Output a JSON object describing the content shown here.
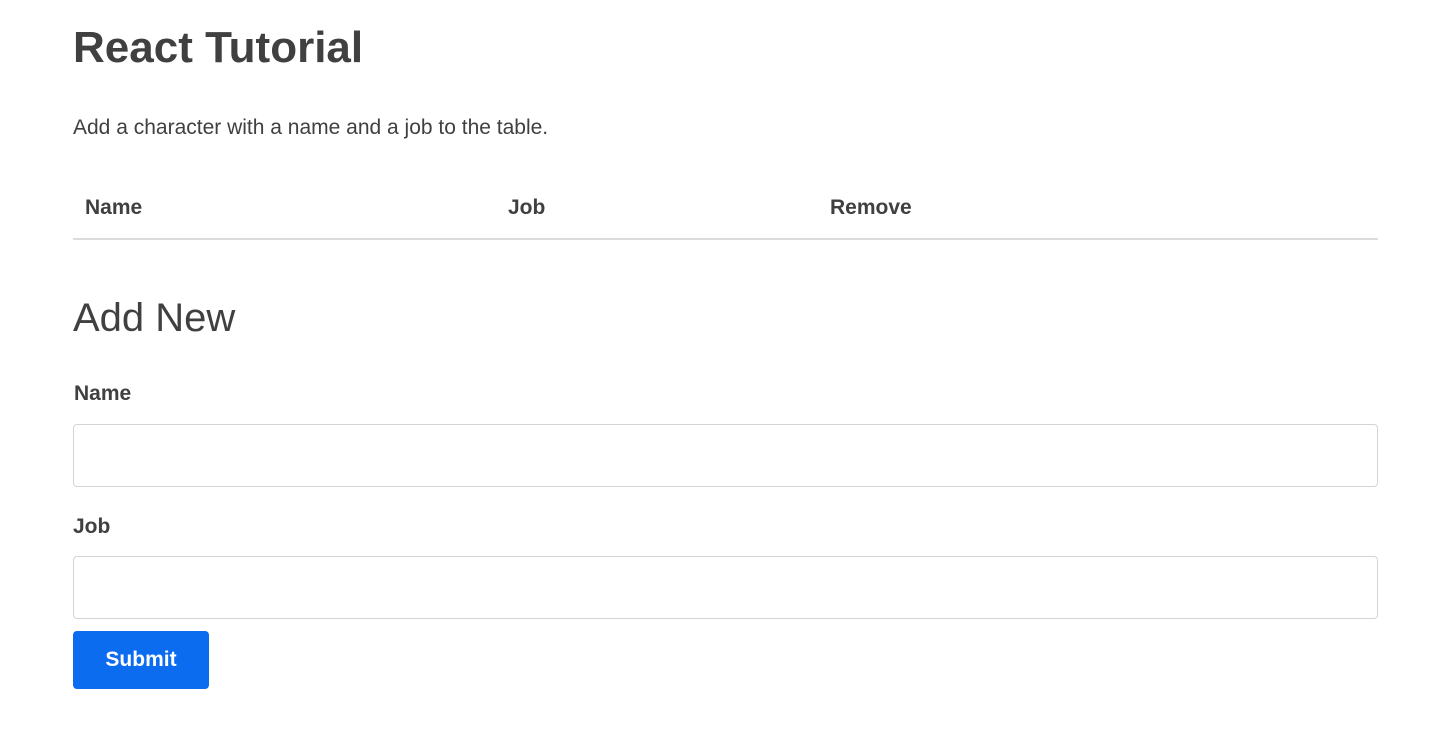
{
  "page": {
    "title": "React Tutorial",
    "intro": "Add a character with a name and a job to the table."
  },
  "table": {
    "columns": [
      "Name",
      "Job",
      "Remove"
    ],
    "rows": []
  },
  "form": {
    "heading": "Add New",
    "name_label": "Name",
    "name_value": "",
    "job_label": "Job",
    "job_value": "",
    "submit_label": "Submit"
  },
  "colors": {
    "text": "#404040",
    "accent": "#0b6cf0",
    "border": "#d4d4d4",
    "divider": "#dcdcdc"
  }
}
